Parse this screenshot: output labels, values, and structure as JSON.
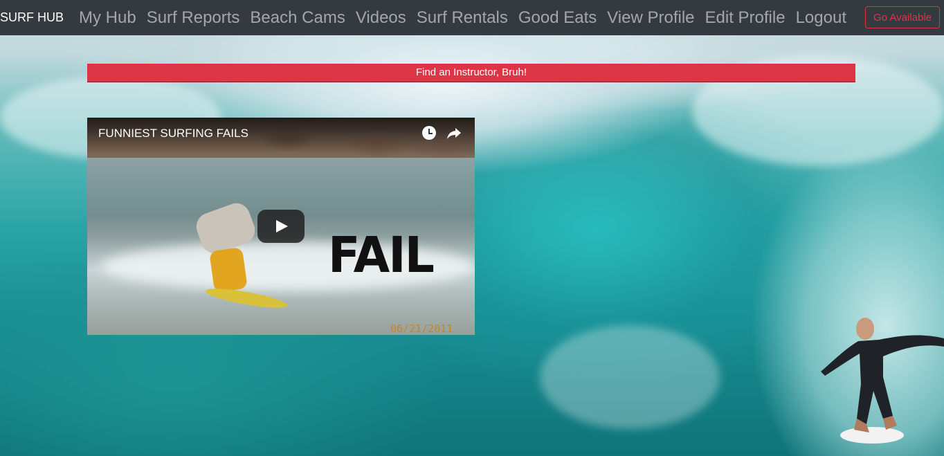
{
  "navbar": {
    "brand": "SURF HUB",
    "links": [
      {
        "label": "My Hub"
      },
      {
        "label": "Surf Reports"
      },
      {
        "label": "Beach Cams"
      },
      {
        "label": "Videos"
      },
      {
        "label": "Surf Rentals"
      },
      {
        "label": "Good Eats"
      },
      {
        "label": "View Profile"
      },
      {
        "label": "Edit Profile"
      },
      {
        "label": "Logout"
      }
    ],
    "status_button": "Go Available"
  },
  "banner": {
    "label": "Find an Instructor, Bruh!"
  },
  "video": {
    "title": "FUNNIEST SURFING FAILS",
    "overlay_text": "FAIL",
    "date_stamp": "06/21/2011",
    "icons": [
      "clock-icon",
      "share-icon",
      "play-icon"
    ]
  },
  "colors": {
    "navbar_bg": "#343a40",
    "accent_red": "#dc3545",
    "nav_link": "rgba(255,255,255,0.55)"
  }
}
